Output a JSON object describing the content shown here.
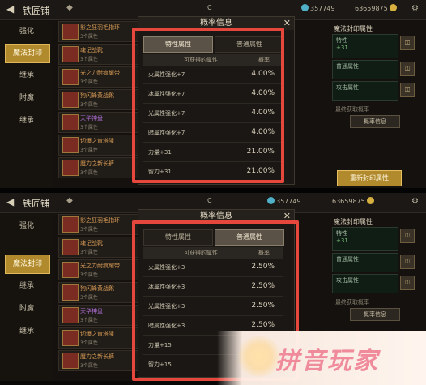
{
  "screens": [
    {
      "title": "铁匠铺",
      "resources": [
        "357749",
        "63659875"
      ],
      "nav": [
        "强化",
        "魔法封印",
        "继承",
        "附魔",
        "继承"
      ],
      "nav_active": 1,
      "list": [
        {
          "name": "影之狂羽毛指环",
          "sub": "3个属性"
        },
        {
          "name": "魂记战靴",
          "sub": "3个属性"
        },
        {
          "name": "光之力耐疯耀带",
          "sub": "3个属性"
        },
        {
          "name": "狗闪蜂黄战靴",
          "sub": "3个属性"
        },
        {
          "name": "天华神盘",
          "sub": "3个属性"
        },
        {
          "name": "切爆之肯塔隆",
          "sub": "3个属性"
        },
        {
          "name": "魔力之新长裤",
          "sub": "3个属性"
        }
      ],
      "modal": {
        "title": "概率信息",
        "tabs": [
          "特性属性",
          "普通属性"
        ],
        "active_tab": 0,
        "col_attr": "可获得的属性",
        "col_rate": "概率",
        "rows": [
          {
            "attr": "火属性强化+7",
            "rate": "4.00%"
          },
          {
            "attr": "冰属性强化+7",
            "rate": "4.00%"
          },
          {
            "attr": "光属性强化+7",
            "rate": "4.00%"
          },
          {
            "attr": "暗属性强化+7",
            "rate": "4.00%"
          },
          {
            "attr": "力量+31",
            "rate": "21.00%"
          },
          {
            "attr": "智力+31",
            "rate": "21.00%"
          }
        ]
      },
      "right": {
        "header": "魔法封印属性",
        "box1_title": "特性",
        "box1_value": "+31",
        "box2_title": "普通属性",
        "box3_title": "攻击属性",
        "note": "最终获取概率",
        "small_btn": "概率信息",
        "big_btn": "重新封印属性"
      }
    },
    {
      "title": "铁匠铺",
      "resources": [
        "357749",
        "63659875"
      ],
      "nav": [
        "强化",
        "魔法封印",
        "继承",
        "附魔",
        "继承"
      ],
      "nav_active": 1,
      "list": [
        {
          "name": "影之狂羽毛指环",
          "sub": "3个属性"
        },
        {
          "name": "魂记战靴",
          "sub": "3个属性"
        },
        {
          "name": "光之力耐疯耀带",
          "sub": "3个属性"
        },
        {
          "name": "狗闪蜂黄战靴",
          "sub": "3个属性"
        },
        {
          "name": "天华神盘",
          "sub": "3个属性"
        },
        {
          "name": "切爆之肯塔隆",
          "sub": "3个属性"
        },
        {
          "name": "魔力之新长裤",
          "sub": "3个属性"
        }
      ],
      "modal": {
        "title": "概率信息",
        "tabs": [
          "特性属性",
          "普通属性"
        ],
        "active_tab": 1,
        "col_attr": "可获得的属性",
        "col_rate": "概率",
        "rows": [
          {
            "attr": "火属性强化+3",
            "rate": "2.50%"
          },
          {
            "attr": "冰属性强化+3",
            "rate": "2.50%"
          },
          {
            "attr": "光属性强化+3",
            "rate": "2.50%"
          },
          {
            "attr": "暗属性强化+3",
            "rate": "2.50%"
          },
          {
            "attr": "力量+15",
            "rate": ""
          },
          {
            "attr": "智力+15",
            "rate": ""
          }
        ]
      },
      "right": {
        "header": "魔法封印属性",
        "box1_title": "特性",
        "box1_value": "+31",
        "box2_title": "普通属性",
        "box3_title": "攻击属性",
        "note": "最终获取概率",
        "small_btn": "概率信息",
        "big_btn": ""
      }
    }
  ],
  "watermark": "拼音玩家",
  "colors": {
    "highlight_frame": "#e5473d",
    "accent_gold": "#b08a2d"
  }
}
